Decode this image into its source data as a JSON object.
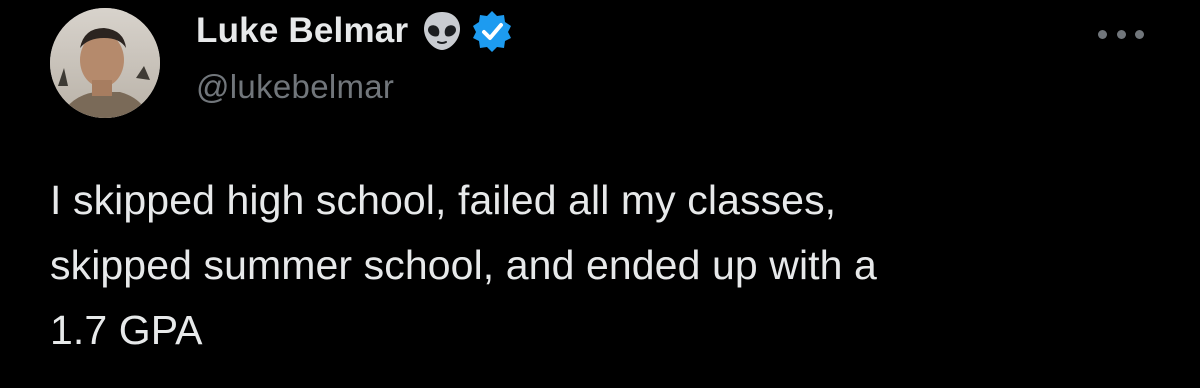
{
  "author": {
    "display_name": "Luke Belmar",
    "handle": "@lukebelmar",
    "badges": [
      "alien-emoji-icon",
      "verified-badge-icon"
    ],
    "avatar_icon": "profile-photo"
  },
  "menu": {
    "icon": "more-horizontal-icon"
  },
  "tweet": {
    "text": "I skipped high school, failed all my classes,\nskipped summer school, and ended up with a\n1.7 GPA"
  },
  "colors": {
    "background": "#000000",
    "primary_text": "#e7e9ea",
    "secondary_text": "#71767b",
    "verified_blue": "#1d9bf0"
  }
}
